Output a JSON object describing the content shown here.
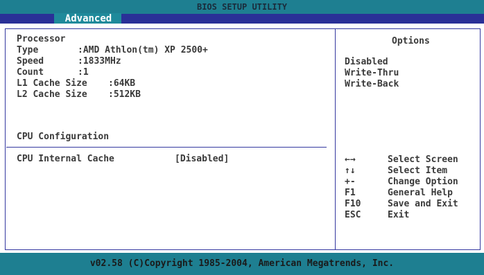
{
  "header": {
    "title": "BIOS SETUP UTILITY",
    "active_tab": "Advanced"
  },
  "left_panel": {
    "processor_heading": "Processor",
    "info": [
      {
        "label": "Type",
        "value": ":AMD Athlon(tm) XP 2500+"
      },
      {
        "label": "Speed",
        "value": ":1833MHz"
      },
      {
        "label": "Count",
        "value": ":1"
      },
      {
        "label": "L1 Cache Size",
        "value": ":64KB"
      },
      {
        "label": "L2 Cache Size",
        "value": ":512KB"
      }
    ],
    "cpu_config_heading": "CPU Configuration",
    "setting": {
      "label": "CPU Internal Cache",
      "value": "[Disabled]"
    }
  },
  "options_panel": {
    "title": "Options",
    "items": [
      "Disabled",
      "Write-Thru",
      "Write-Back"
    ]
  },
  "help": [
    {
      "key": "←→",
      "desc": "Select Screen"
    },
    {
      "key": "↑↓",
      "desc": "Select Item"
    },
    {
      "key": "+-",
      "desc": "Change Option"
    },
    {
      "key": "F1",
      "desc": "General Help"
    },
    {
      "key": "F10",
      "desc": "Save and Exit"
    },
    {
      "key": "ESC",
      "desc": "Exit"
    }
  ],
  "footer": {
    "text": "v02.58 (C)Copyright 1985-2004, American Megatrends, Inc."
  },
  "colors": {
    "title_bar": "#1e7f91",
    "tab_bar": "#2a3097",
    "active_tab": "#1f8a9b",
    "frame_lines": "#3438a0",
    "text": "#3a3a3a"
  }
}
